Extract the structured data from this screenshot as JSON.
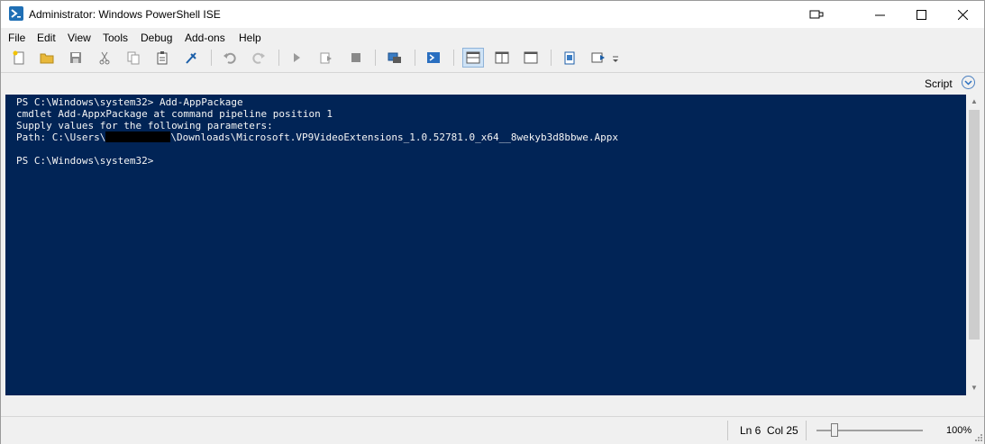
{
  "window": {
    "title": "Administrator: Windows PowerShell ISE"
  },
  "menu": {
    "items": [
      "File",
      "Edit",
      "View",
      "Tools",
      "Debug",
      "Add-ons",
      "Help"
    ]
  },
  "toolbar": {
    "icons": [
      "new-icon",
      "open-icon",
      "save-icon",
      "cut-icon",
      "copy-icon",
      "paste-icon",
      "run-powershell-icon",
      "undo-icon",
      "redo-icon",
      "run-icon",
      "run-selection-icon",
      "stop-icon",
      "remote-icon",
      "powershell-icon",
      "pane-top-icon",
      "pane-right-icon",
      "pane-max-icon",
      "show-script-icon",
      "show-commands-icon",
      "overflow-icon"
    ]
  },
  "script_pane": {
    "label": "Script"
  },
  "console": {
    "line1": "PS C:\\Windows\\system32> Add-AppPackage",
    "line2": "cmdlet Add-AppxPackage at command pipeline position 1",
    "line3": "Supply values for the following parameters:",
    "line4_prefix": "Path: C:\\Users\\",
    "line4_suffix": "\\Downloads\\Microsoft.VP9VideoExtensions_1.0.52781.0_x64__8wekyb3d8bbwe.Appx",
    "line6": "PS C:\\Windows\\system32>"
  },
  "status": {
    "ln": "Ln 6",
    "col": "Col 25",
    "zoom": "100%",
    "zoom_level": 0.17
  },
  "colors": {
    "console_bg": "#012456",
    "console_fg": "#f5f5f5"
  }
}
